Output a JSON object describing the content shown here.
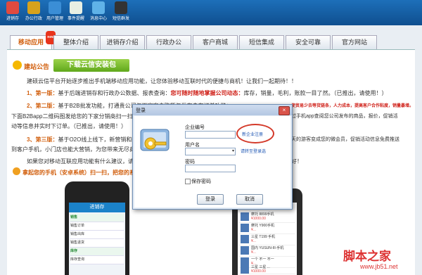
{
  "toolbar": {
    "items": [
      {
        "label": "进销存",
        "icon": "inventory-icon",
        "color": "#e04a3f"
      },
      {
        "label": "办公行政",
        "icon": "tools-icon",
        "color": "#d7a21c"
      },
      {
        "label": "用户管理",
        "icon": "users-icon",
        "color": "#3b8ed6"
      },
      {
        "label": "事件提醒",
        "icon": "calendar-icon",
        "color": "#e8efe3"
      },
      {
        "label": "消息中心",
        "icon": "chat-icon",
        "color": "#5fb2e8"
      },
      {
        "label": "短信群发",
        "icon": "phone-icon",
        "color": "#333333"
      }
    ]
  },
  "tabs": [
    "移动应用",
    "整体介绍",
    "进销存介绍",
    "行政办公",
    "客户商城",
    "短信集成",
    "安全可靠",
    "官方网站"
  ],
  "tab_badge": "new",
  "announcement": {
    "title": "建站公告",
    "download_button": "下载云信安装包"
  },
  "intro": {
    "line1": "建硕云信平台开始逐步推出手机端移动应用功能，让您体验移动互联时代的便捷与商机！让我们一起期待！！",
    "p1_prefix": "1、第一版：",
    "p1_text": "基于后端进销存和行政办公数据、报表查询：",
    "p1_red": "您可随时随地掌握公司动态：",
    "p1_tail": "库存，销量，毛利，账款一目了然。（已推出，请使用！）",
    "p2_prefix": "2、第二版：",
    "p2_text": "基于B2B批发功能，打通贵公司与下家客户购货与发布自在订单功能：",
    "p2_red": "使贸易少去等货链条，人力成本，提高客户合作粘度，销量暴增。",
    "p2_tail": "可把",
    "p2_line2": "下面B2Bapp二维码图发给您的下家分销商扫一扫",
    "p2_line2b": "过手机app查阅您公司发布的商品，报价，促销活",
    "p2_line3": "动等信息并实时下订单。（已推出，请使用！）",
    "p3_prefix": "3、第三版：",
    "p3_text": "基于O2O线上线下，新营销和新",
    "p3_tail": "天的游客变成您的微会员，促销活动信息免费推送",
    "p3_line2": "到客户手机，小门店也能大营销，为您带来无尽商",
    "line4": "如果您对移动互联应用功能有什么建议，请在",
    "line4_tail": "好！",
    "qr_title": "拿起您的手机（安卓系统）扫一扫，把您的系"
  },
  "phone_app": {
    "title": "进销存",
    "sections": [
      "销售",
      "销售订单",
      "销售出库",
      "销售退货",
      "库存",
      "库存查询"
    ]
  },
  "phone_shop": {
    "items": [
      {
        "name": "摩托 8899手机",
        "price": "¥1000.00"
      },
      {
        "name": "摩托 Y900手机",
        "price": "¥..."
      },
      {
        "name": "三星 T199 手机",
        "price": "¥..."
      },
      {
        "name": "国内 YUSUN-III-手机",
        "price": "¥..."
      },
      {
        "name": "一个 不一 不一",
        "price": "¥..."
      },
      {
        "name": "三星 三星 ...",
        "price": "¥1000.00"
      }
    ]
  },
  "login_dialog": {
    "title": "登录",
    "company_label": "企业编号",
    "register_link": "新企业注册",
    "user_label": "用户名",
    "lookup_link": "请转至登录选",
    "password_label": "密码",
    "remember_label": "保存密码",
    "login_button": "登录",
    "cancel_button": "取消"
  },
  "watermark": {
    "main": "脚本之家",
    "url": "www.jb51.net"
  }
}
